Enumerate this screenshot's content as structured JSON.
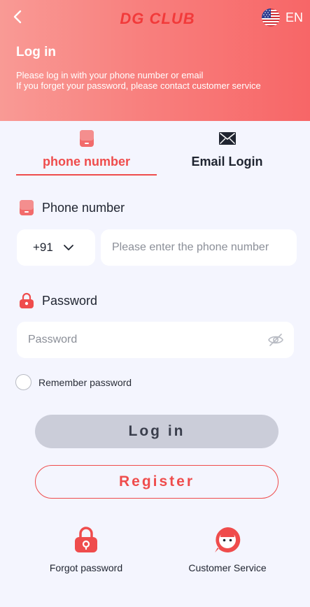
{
  "header": {
    "brand": "DG CLUB",
    "language": "EN",
    "title": "Log in",
    "subtitle_line1": "Please log in with your phone number or email",
    "subtitle_line2": "If you forget your password, please contact customer service"
  },
  "tabs": [
    {
      "label": "phone number",
      "icon": "phone-icon",
      "active": true
    },
    {
      "label": "Email Login",
      "icon": "mail-icon",
      "active": false
    }
  ],
  "phone": {
    "label": "Phone number",
    "country_code": "+91",
    "placeholder": "Please enter the phone number",
    "value": ""
  },
  "password": {
    "label": "Password",
    "placeholder": "Password",
    "value": ""
  },
  "remember": {
    "label": "Remember password",
    "checked": false
  },
  "buttons": {
    "login": "Log in",
    "register": "Register"
  },
  "bottom": {
    "forgot": "Forgot password",
    "service": "Customer Service"
  },
  "colors": {
    "accent": "#ef4c4c",
    "header_start": "#f99a95",
    "header_end": "#f76667",
    "background": "#f4f5fe",
    "login_button": "#cbcdd9"
  }
}
